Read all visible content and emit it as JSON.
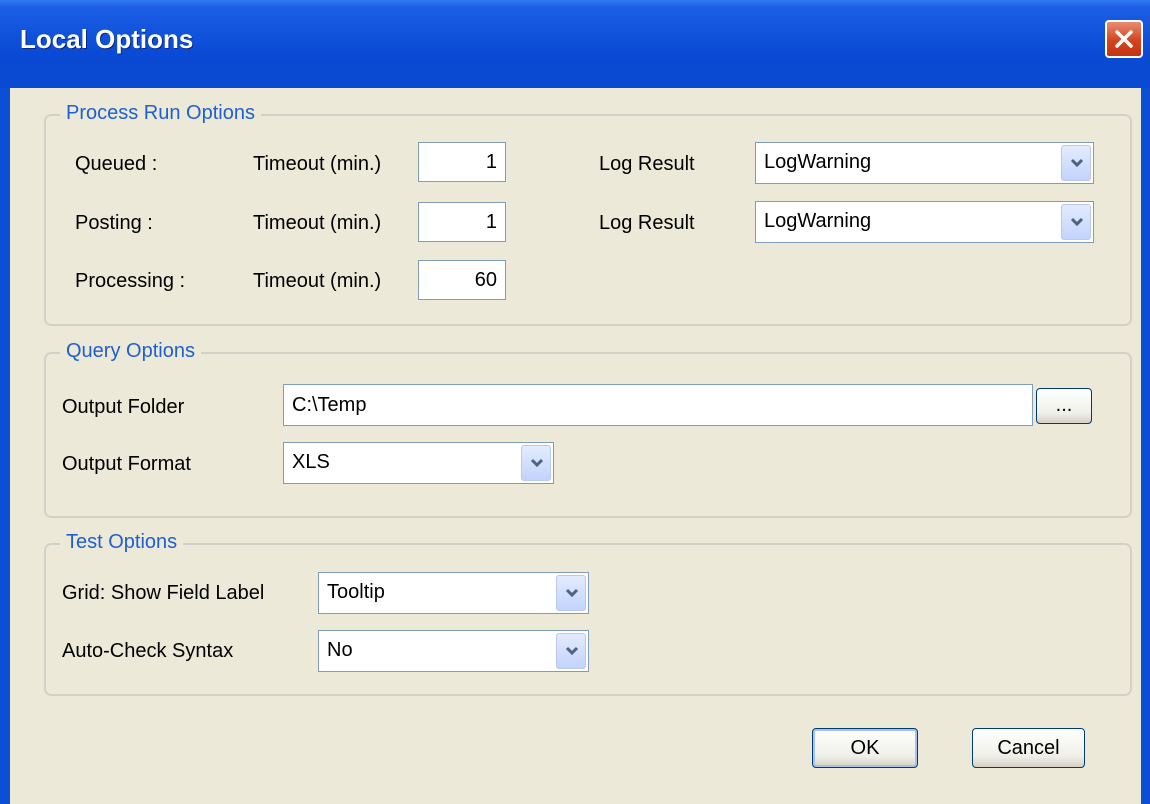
{
  "window": {
    "title": "Local Options"
  },
  "process_run": {
    "legend": "Process Run Options",
    "rows": [
      {
        "label": "Queued :",
        "timeout_label": "Timeout (min.)",
        "timeout": "1",
        "log_label": "Log Result",
        "log_value": "LogWarning"
      },
      {
        "label": "Posting :",
        "timeout_label": "Timeout (min.)",
        "timeout": "1",
        "log_label": "Log Result",
        "log_value": "LogWarning"
      },
      {
        "label": "Processing :",
        "timeout_label": "Timeout (min.)",
        "timeout": "60"
      }
    ]
  },
  "query": {
    "legend": "Query Options",
    "output_folder_label": "Output Folder",
    "output_folder": "C:\\Temp",
    "browse_label": "...",
    "output_format_label": "Output Format",
    "output_format": "XLS"
  },
  "test": {
    "legend": "Test Options",
    "grid_label": "Grid: Show Field Label",
    "grid_value": "Tooltip",
    "autocheck_label": "Auto-Check Syntax",
    "autocheck_value": "No"
  },
  "buttons": {
    "ok": "OK",
    "cancel": "Cancel"
  },
  "icons": {
    "close": "close-icon",
    "dropdown": "chevron-down-icon"
  },
  "colors": {
    "titlebar": "#0a4ad4",
    "dialog_bg": "#ece9d8",
    "legend": "#1f5fcf",
    "close": "#d4441e"
  }
}
